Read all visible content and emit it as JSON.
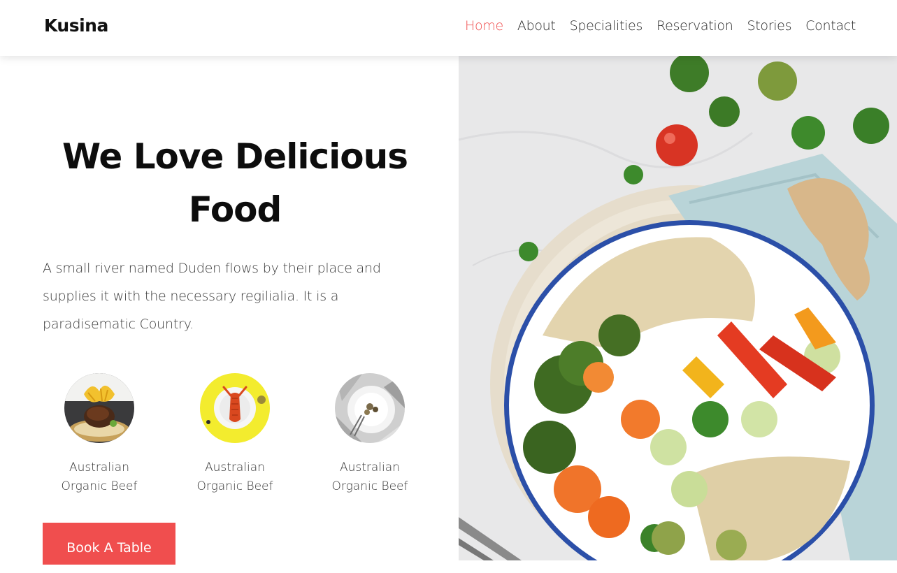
{
  "header": {
    "brand": "Kusina",
    "nav": [
      {
        "label": "Home",
        "active": true
      },
      {
        "label": "About",
        "active": false
      },
      {
        "label": "Specialities",
        "active": false
      },
      {
        "label": "Reservation",
        "active": false
      },
      {
        "label": "Stories",
        "active": false
      },
      {
        "label": "Contact",
        "active": false
      }
    ]
  },
  "hero": {
    "title_line1": "We Love Delicious",
    "title_line2": "Food",
    "description": "A small river named Duden flows by their place and supplies it with the necessary regilialia. It is a paradisematic Country.",
    "features": [
      {
        "line1": "Australian",
        "line2": "Organic Beef",
        "icon": "beef-dish-photo"
      },
      {
        "line1": "Australian",
        "line2": "Organic Beef",
        "icon": "lobster-dish-photo"
      },
      {
        "line1": "Australian",
        "line2": "Organic Beef",
        "icon": "plated-dish-photo"
      }
    ],
    "cta_label": "Book A Table",
    "image_icon": "salad-bowl-photo"
  },
  "colors": {
    "accent": "#f04e4e",
    "text": "#111111",
    "muted": "#3a3a3a",
    "background": "#ffffff"
  }
}
